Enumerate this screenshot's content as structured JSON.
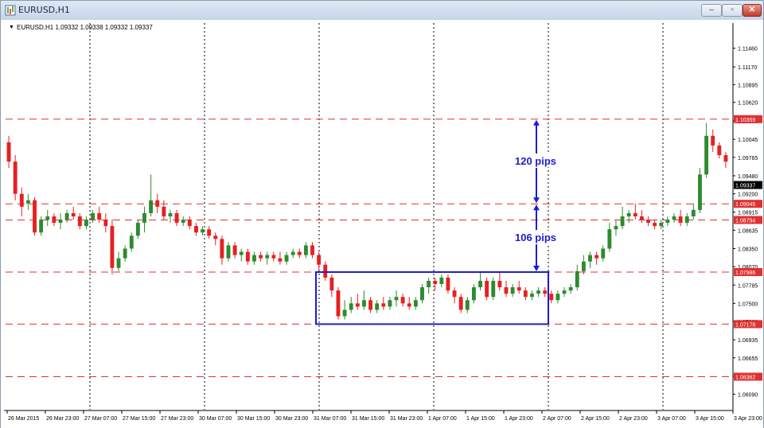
{
  "window": {
    "title": "EURUSD,H1",
    "minimize_glyph": "‒",
    "maximize_glyph": "▫",
    "close_glyph": "✕"
  },
  "chart_header": {
    "text": "EURUSD,H1  1.09332 1.09338 1.09332 1.09337",
    "marker": "▼"
  },
  "chart_data": {
    "type": "candlestick",
    "symbol": "EURUSD",
    "timeframe": "H1",
    "ohlc_current": {
      "open": 1.09332,
      "high": 1.09338,
      "low": 1.09332,
      "close": 1.09337
    },
    "ylim": [
      1.0585,
      1.1185
    ],
    "y_ticks": [
      "1.11460",
      "1.11170",
      "1.10895",
      "1.10620",
      "1.10330",
      "1.10045",
      "1.09765",
      "1.09480",
      "1.09200",
      "1.08915",
      "1.08635",
      "1.08350",
      "1.08070",
      "1.07785",
      "1.07500",
      "1.07220",
      "1.06935",
      "1.06655",
      "1.06370",
      "1.06090"
    ],
    "x_ticks": [
      "26 Mar 2015",
      "26 Mar 23:00",
      "27 Mar 07:00",
      "27 Mar 15:00",
      "27 Mar 23:00",
      "30 Mar 07:00",
      "30 Mar 15:00",
      "30 Mar 23:00",
      "31 Mar 07:00",
      "31 Mar 15:00",
      "31 Mar 23:00",
      "1 Apr 07:00",
      "1 Apr 15:00",
      "1 Apr 23:00",
      "2 Apr 07:00",
      "2 Apr 15:00",
      "2 Apr 23:00",
      "3 Apr 07:00",
      "3 Apr 15:00",
      "3 Apr 23:00"
    ],
    "x_ticks_visible_count": 20,
    "vertical_grid_dates": [
      "26 Mar 23:00",
      "27 Mar 23:00",
      "30 Mar 23:00",
      "31 Mar 23:00",
      "1 Apr 23:00",
      "2 Apr 23:00"
    ],
    "current_price": "1.09337",
    "horizontal_levels": [
      {
        "price": 1.10359,
        "label": "1.10359"
      },
      {
        "price": 1.09045,
        "label": "1.09045"
      },
      {
        "price": 1.08794,
        "label": "1.08794"
      },
      {
        "price": 1.07986,
        "label": "1.07986"
      },
      {
        "price": 1.07178,
        "label": "1.07178"
      },
      {
        "price": 1.06362,
        "label": "1.06362"
      }
    ],
    "range_box": {
      "from": "31 Mar 07:00",
      "to": "2 Apr 07:00",
      "top": 1.07986,
      "bottom": 1.07178
    },
    "annotations": [
      {
        "text": "120 pips",
        "from_price": 1.09045,
        "to_price": 1.10359
      },
      {
        "text": "106 pips",
        "from_price": 1.07986,
        "to_price": 1.09045
      }
    ],
    "candles": [
      [
        1.1,
        1.101,
        1.096,
        1.097
      ],
      [
        1.097,
        1.098,
        1.091,
        1.092
      ],
      [
        1.092,
        1.093,
        1.0885,
        1.09
      ],
      [
        1.0905,
        1.092,
        1.0895,
        1.091
      ],
      [
        1.091,
        1.0915,
        1.0855,
        1.086
      ],
      [
        1.086,
        1.0885,
        1.0855,
        1.088
      ],
      [
        1.088,
        1.0895,
        1.087,
        1.0885
      ],
      [
        1.0885,
        1.089,
        1.087,
        1.0875
      ],
      [
        1.0875,
        1.089,
        1.0865,
        1.088
      ],
      [
        1.088,
        1.0895,
        1.0875,
        1.089
      ],
      [
        1.089,
        1.09,
        1.088,
        1.0885
      ],
      [
        1.0885,
        1.089,
        1.0865,
        1.087
      ],
      [
        1.087,
        1.0885,
        1.0865,
        1.088
      ],
      [
        1.088,
        1.0895,
        1.0875,
        1.089
      ],
      [
        1.089,
        1.09,
        1.0875,
        1.088
      ],
      [
        1.088,
        1.089,
        1.086,
        1.087
      ],
      [
        1.087,
        1.088,
        1.0795,
        1.0805
      ],
      [
        1.0805,
        1.083,
        1.08,
        1.082
      ],
      [
        1.082,
        1.084,
        1.0815,
        1.0835
      ],
      [
        1.0835,
        1.086,
        1.083,
        1.0855
      ],
      [
        1.0855,
        1.088,
        1.085,
        1.0875
      ],
      [
        1.0875,
        1.09,
        1.086,
        1.089
      ],
      [
        1.089,
        1.095,
        1.0885,
        1.091
      ],
      [
        1.091,
        1.092,
        1.089,
        1.09
      ],
      [
        1.09,
        1.091,
        1.088,
        1.0885
      ],
      [
        1.0885,
        1.0895,
        1.0875,
        1.089
      ],
      [
        1.089,
        1.0895,
        1.087,
        1.0875
      ],
      [
        1.0875,
        1.0885,
        1.087,
        1.088
      ],
      [
        1.088,
        1.0885,
        1.0865,
        1.087
      ],
      [
        1.087,
        1.0875,
        1.0855,
        1.086
      ],
      [
        1.086,
        1.087,
        1.0855,
        1.0865
      ],
      [
        1.0865,
        1.087,
        1.085,
        1.0855
      ],
      [
        1.0855,
        1.086,
        1.084,
        1.085
      ],
      [
        1.085,
        1.0855,
        1.081,
        1.082
      ],
      [
        1.082,
        1.0845,
        1.0815,
        1.084
      ],
      [
        1.084,
        1.0845,
        1.082,
        1.0825
      ],
      [
        1.0825,
        1.0835,
        1.0815,
        1.083
      ],
      [
        1.083,
        1.0835,
        1.081,
        1.0815
      ],
      [
        1.0815,
        1.083,
        1.081,
        1.0825
      ],
      [
        1.0825,
        1.083,
        1.0815,
        1.082
      ],
      [
        1.082,
        1.083,
        1.081,
        1.0825
      ],
      [
        1.0825,
        1.083,
        1.0815,
        1.082
      ],
      [
        1.082,
        1.083,
        1.081,
        1.0815
      ],
      [
        1.0815,
        1.083,
        1.081,
        1.0825
      ],
      [
        1.0825,
        1.0835,
        1.082,
        1.083
      ],
      [
        1.083,
        1.0835,
        1.082,
        1.0825
      ],
      [
        1.0825,
        1.0845,
        1.082,
        1.084
      ],
      [
        1.084,
        1.0845,
        1.082,
        1.0825
      ],
      [
        1.0825,
        1.083,
        1.08,
        1.081
      ],
      [
        1.081,
        1.0815,
        1.0785,
        1.079
      ],
      [
        1.079,
        1.0795,
        1.076,
        1.077
      ],
      [
        1.077,
        1.0775,
        1.0725,
        1.073
      ],
      [
        1.073,
        1.0755,
        1.0725,
        1.074
      ],
      [
        1.074,
        1.076,
        1.0735,
        1.075
      ],
      [
        1.075,
        1.0765,
        1.074,
        1.0745
      ],
      [
        1.0745,
        1.077,
        1.074,
        1.0755
      ],
      [
        1.0755,
        1.076,
        1.0735,
        1.074
      ],
      [
        1.074,
        1.0755,
        1.0735,
        1.075
      ],
      [
        1.075,
        1.076,
        1.074,
        1.0745
      ],
      [
        1.0745,
        1.076,
        1.074,
        1.0755
      ],
      [
        1.0755,
        1.077,
        1.0745,
        1.076
      ],
      [
        1.076,
        1.0765,
        1.0745,
        1.075
      ],
      [
        1.075,
        1.076,
        1.074,
        1.0745
      ],
      [
        1.0745,
        1.076,
        1.074,
        1.0755
      ],
      [
        1.0755,
        1.078,
        1.075,
        1.0775
      ],
      [
        1.0775,
        1.079,
        1.0765,
        1.0785
      ],
      [
        1.0785,
        1.079,
        1.077,
        1.078
      ],
      [
        1.078,
        1.0795,
        1.0775,
        1.079
      ],
      [
        1.079,
        1.0795,
        1.0765,
        1.077
      ],
      [
        1.077,
        1.0775,
        1.075,
        1.076
      ],
      [
        1.076,
        1.0765,
        1.0735,
        1.074
      ],
      [
        1.074,
        1.076,
        1.0735,
        1.0755
      ],
      [
        1.0755,
        1.078,
        1.075,
        1.0775
      ],
      [
        1.0775,
        1.08,
        1.077,
        1.0785
      ],
      [
        1.0785,
        1.079,
        1.0755,
        1.076
      ],
      [
        1.076,
        1.079,
        1.0755,
        1.0785
      ],
      [
        1.0785,
        1.08,
        1.077,
        1.0775
      ],
      [
        1.0775,
        1.0785,
        1.076,
        1.0765
      ],
      [
        1.0765,
        1.078,
        1.076,
        1.0775
      ],
      [
        1.0775,
        1.0785,
        1.0765,
        1.077
      ],
      [
        1.077,
        1.0775,
        1.0755,
        1.076
      ],
      [
        1.076,
        1.077,
        1.0755,
        1.0765
      ],
      [
        1.0765,
        1.0775,
        1.076,
        1.077
      ],
      [
        1.077,
        1.0775,
        1.076,
        1.0765
      ],
      [
        1.0765,
        1.077,
        1.075,
        1.0755
      ],
      [
        1.0755,
        1.077,
        1.075,
        1.0765
      ],
      [
        1.0765,
        1.0775,
        1.076,
        1.077
      ],
      [
        1.077,
        1.078,
        1.0765,
        1.0775
      ],
      [
        1.0775,
        1.081,
        1.077,
        1.08
      ],
      [
        1.08,
        1.0825,
        1.0795,
        1.0815
      ],
      [
        1.0815,
        1.083,
        1.0805,
        1.0825
      ],
      [
        1.0825,
        1.083,
        1.081,
        1.082
      ],
      [
        1.082,
        1.084,
        1.0815,
        1.0835
      ],
      [
        1.0835,
        1.0875,
        1.083,
        1.0865
      ],
      [
        1.0865,
        1.088,
        1.0855,
        1.087
      ],
      [
        1.087,
        1.09,
        1.0865,
        1.0885
      ],
      [
        1.0885,
        1.0895,
        1.0875,
        1.089
      ],
      [
        1.089,
        1.0905,
        1.088,
        1.0885
      ],
      [
        1.0885,
        1.0895,
        1.0875,
        1.088
      ],
      [
        1.088,
        1.0885,
        1.087,
        1.0875
      ],
      [
        1.0875,
        1.088,
        1.0865,
        1.087
      ],
      [
        1.087,
        1.088,
        1.0865,
        1.0875
      ],
      [
        1.0875,
        1.0885,
        1.087,
        1.088
      ],
      [
        1.088,
        1.089,
        1.0875,
        1.0885
      ],
      [
        1.0885,
        1.0895,
        1.087,
        1.0875
      ],
      [
        1.0875,
        1.089,
        1.087,
        1.0885
      ],
      [
        1.0885,
        1.0905,
        1.088,
        1.0895
      ],
      [
        1.0895,
        1.096,
        1.089,
        1.095
      ],
      [
        1.095,
        1.103,
        1.0945,
        1.101
      ],
      [
        1.101,
        1.102,
        1.0985,
        1.0995
      ],
      [
        1.0995,
        1.1,
        1.0975,
        1.098
      ],
      [
        1.098,
        1.0985,
        1.096,
        1.097
      ]
    ],
    "up_color": "#2e8b2e",
    "down_color": "#e62020",
    "level_color": "#e03030",
    "box_color": "#1c1ccf",
    "annotation_color": "#1c1ccf",
    "grid": "vertical-dotted"
  }
}
